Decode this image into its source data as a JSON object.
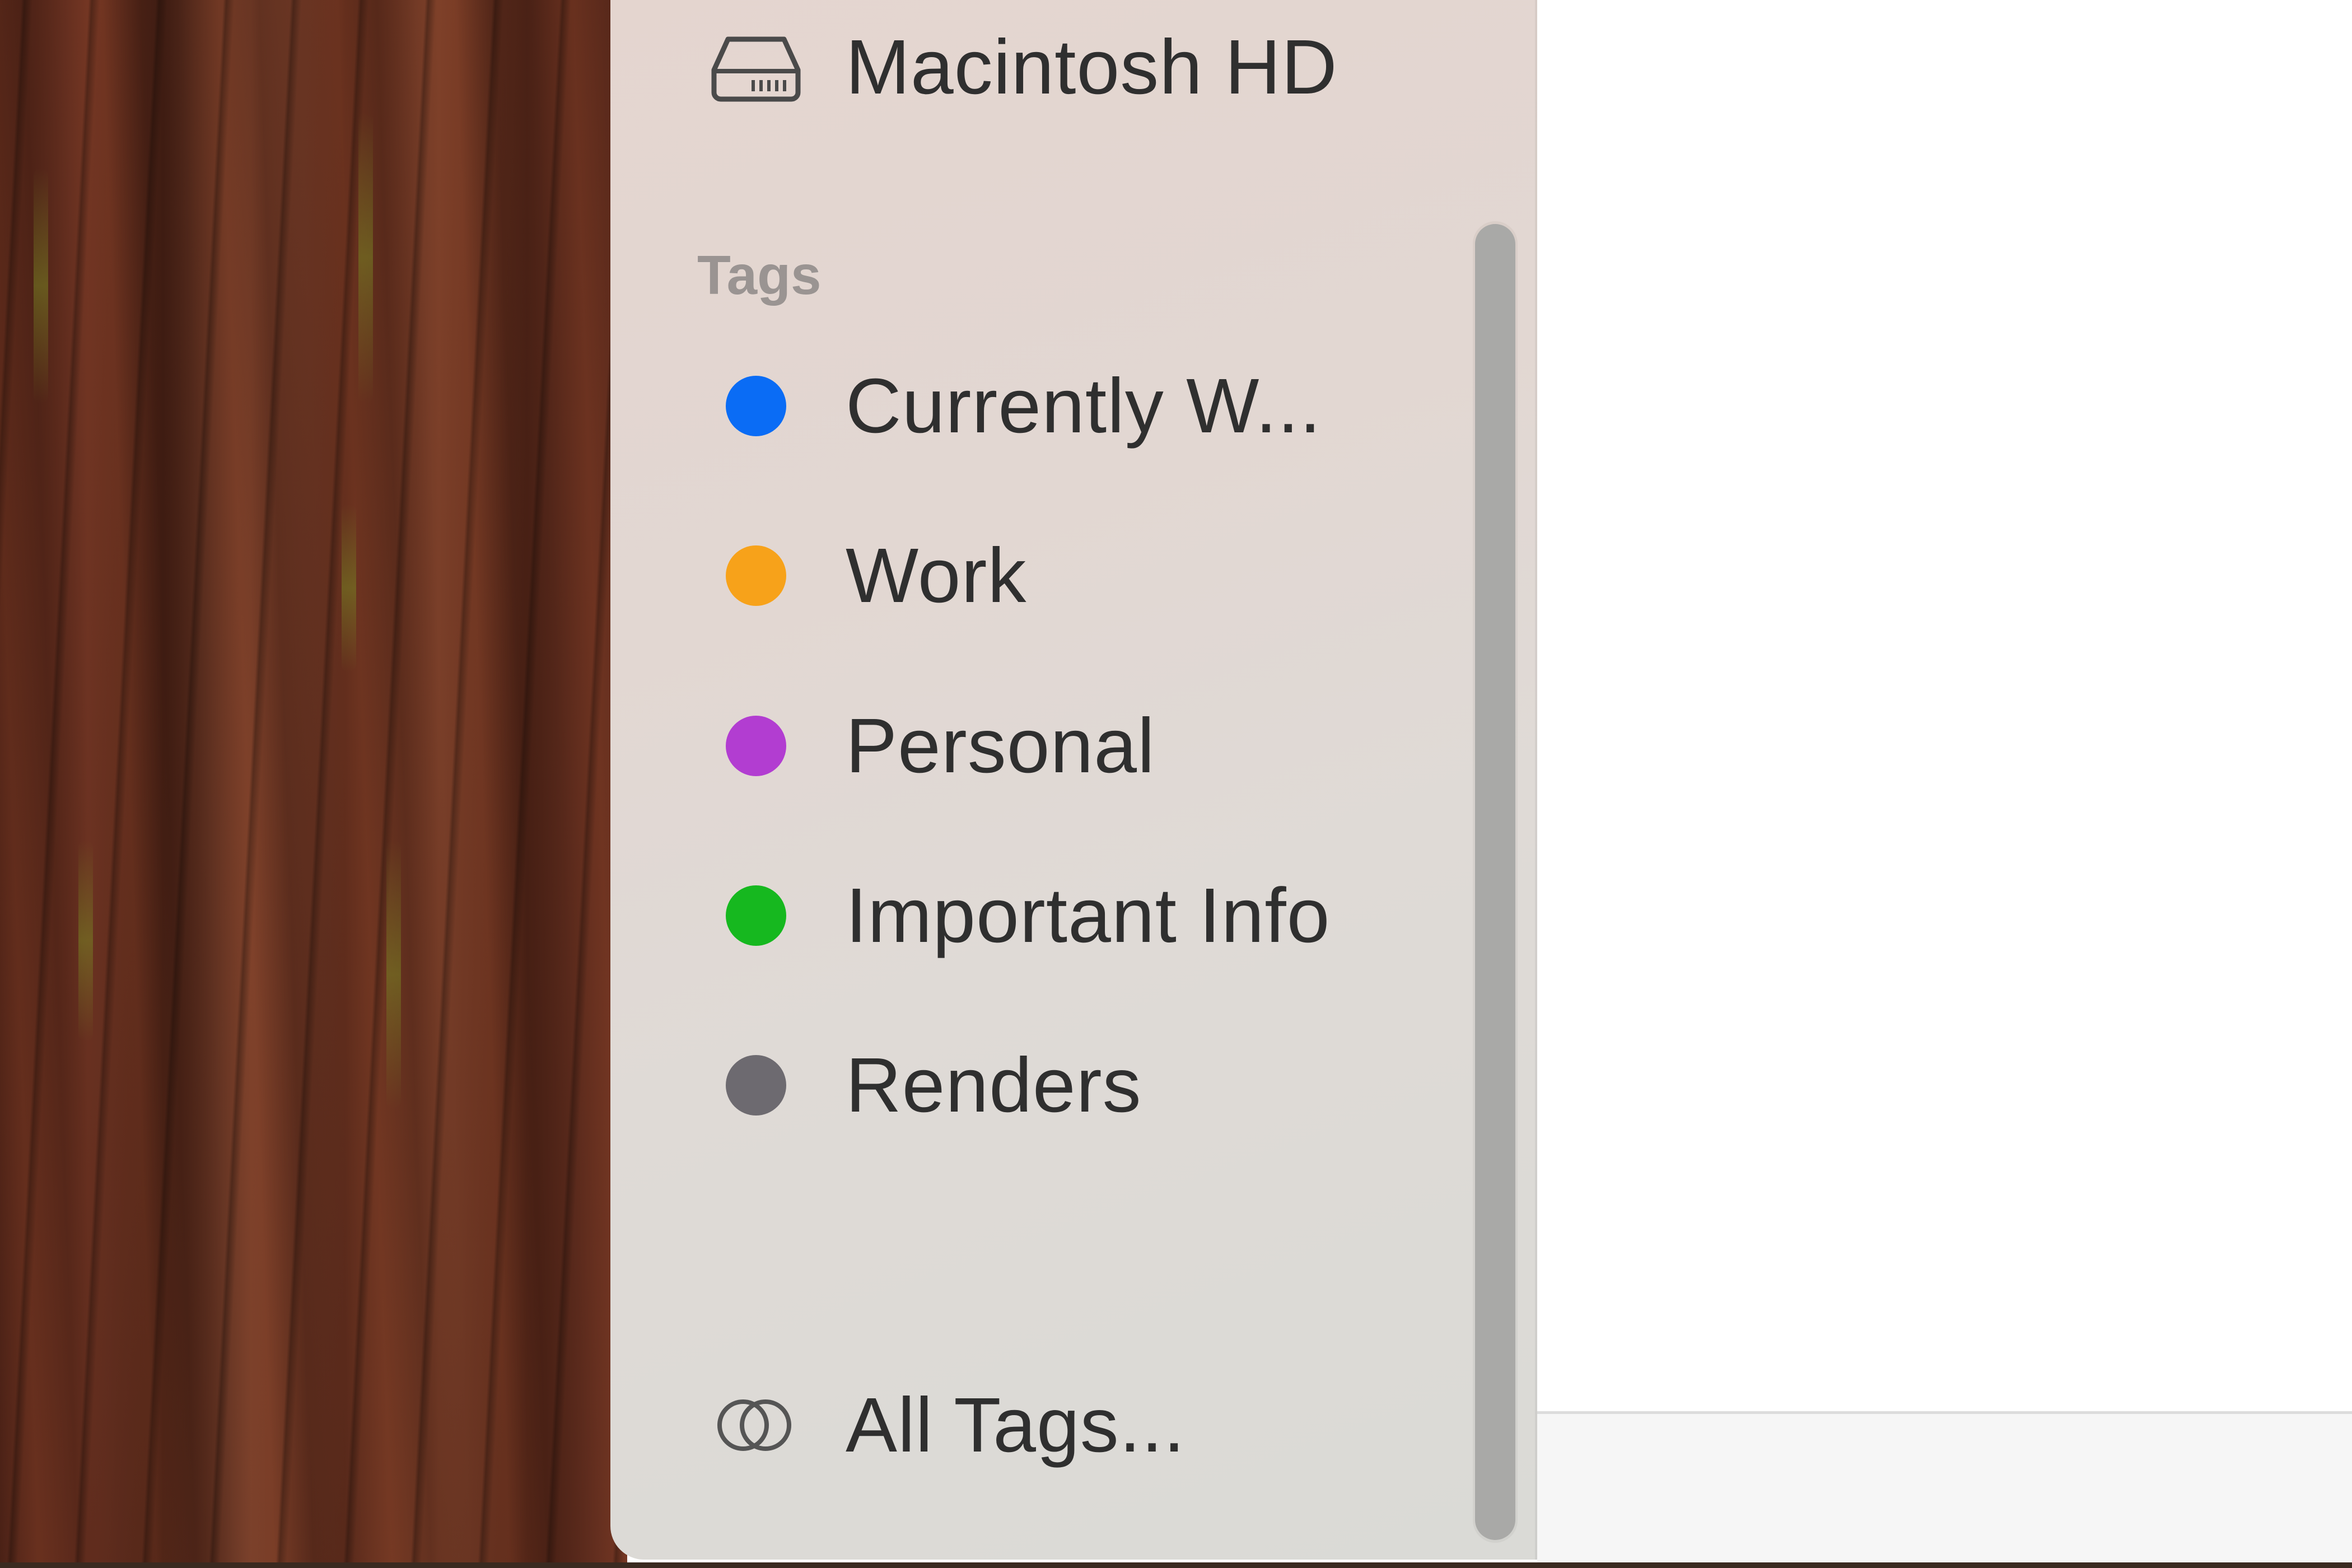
{
  "sidebar": {
    "locations": [
      {
        "label": "Macintosh HD",
        "icon": "hard-drive-icon"
      }
    ],
    "tags_header": "Tags",
    "tags": [
      {
        "label": "Currently W...",
        "color": "#0a6cf5"
      },
      {
        "label": "Work",
        "color": "#f7a21a"
      },
      {
        "label": "Personal",
        "color": "#b23dd1"
      },
      {
        "label": "Important Info",
        "color": "#16b81f"
      },
      {
        "label": "Renders",
        "color": "#6d6a70"
      }
    ],
    "all_tags": {
      "label": "All Tags...",
      "icon": "all-tags-icon"
    }
  }
}
